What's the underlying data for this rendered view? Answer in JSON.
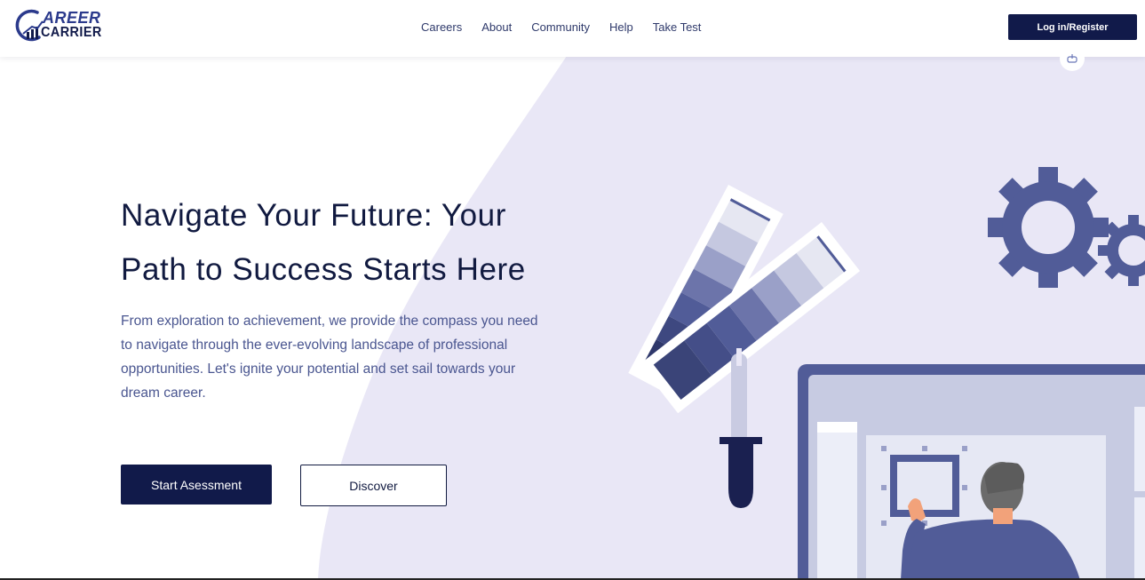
{
  "brand": {
    "logo_top": "AREER",
    "logo_bottom": "CARRIER",
    "logo_full": "Career Carrier"
  },
  "nav": {
    "items": [
      {
        "label": "Careers"
      },
      {
        "label": "About"
      },
      {
        "label": "Community"
      },
      {
        "label": "Help"
      },
      {
        "label": "Take Test"
      }
    ],
    "login_label": "Log in/Register"
  },
  "hero": {
    "title_line1": "Navigate Your Future: Your",
    "title_line2": "Path to Success Starts Here",
    "description": "From exploration to achievement, we provide the compass you need to navigate through the ever-evolving landscape of professional opportunities. Let's ignite your potential and set sail towards your dream career.",
    "primary_label": "Start Asessment",
    "secondary_label": "Discover"
  },
  "colors": {
    "brand_dark": "#111a4a",
    "accent": "#515c98",
    "blob": "#e9e7f6",
    "text_muted": "#4a5690"
  },
  "icons": {
    "share": "share-icon",
    "gear": "gear-icon"
  }
}
